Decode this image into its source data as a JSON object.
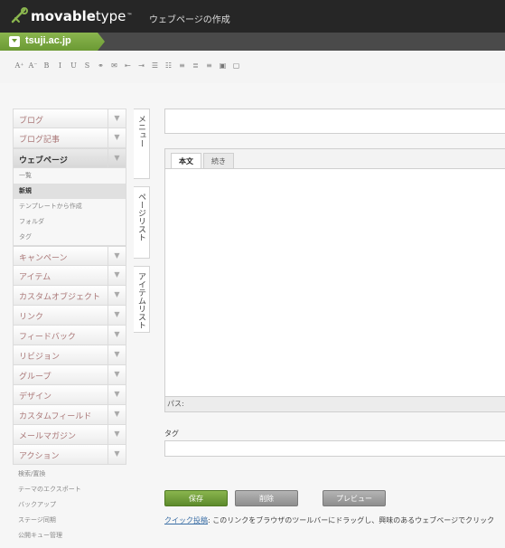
{
  "header": {
    "logo_bold": "movable",
    "logo_light": "type",
    "logo_tm": "™",
    "page_title": "ウェブページの作成"
  },
  "blog": {
    "name": "tsuji.ac.jp"
  },
  "toolbar": {
    "buttons": [
      "A⁺",
      "A⁻",
      "B",
      "I",
      "U",
      "S",
      "⚭",
      "✉",
      "⇤",
      "⇥",
      "☰",
      "☷",
      "≡",
      "≣",
      "≡",
      "▣",
      "▢"
    ]
  },
  "sidebar": {
    "menus_top": [
      {
        "label": "ブログ"
      },
      {
        "label": "ブログ記事"
      }
    ],
    "open_menu": "ウェブページ",
    "submenu": [
      {
        "label": "一覧",
        "active": false
      },
      {
        "label": "新規",
        "active": true
      },
      {
        "label": "テンプレートから作成",
        "active": false
      },
      {
        "label": "フォルダ",
        "active": false
      },
      {
        "label": "タグ",
        "active": false
      }
    ],
    "menus_bottom": [
      {
        "label": "キャンペーン"
      },
      {
        "label": "アイテム"
      },
      {
        "label": "カスタムオブジェクト"
      },
      {
        "label": "リンク"
      },
      {
        "label": "フィードバック"
      },
      {
        "label": "リビジョン"
      },
      {
        "label": "グループ"
      },
      {
        "label": "デザイン"
      },
      {
        "label": "カスタムフィールド"
      },
      {
        "label": "メールマガジン"
      },
      {
        "label": "アクション"
      }
    ],
    "extra_items": [
      "検索/置換",
      "テーマのエクスポート",
      "バックアップ",
      "ステージ同期",
      "公開キュー管理"
    ]
  },
  "vertical_tabs": {
    "menu": "メニュー",
    "page_list": "ページリスト",
    "item_list": "アイテムリスト"
  },
  "editor": {
    "tabs": [
      "本文",
      "続き"
    ],
    "path_label": "パス:"
  },
  "tags": {
    "label": "タグ"
  },
  "actions": {
    "save": "保存",
    "delete": "削除",
    "preview": "プレビュー"
  },
  "quickpost": {
    "link": "クイック投稿",
    "text": ": このリンクをブラウザのツールバーにドラッグし、興味のあるウェブページでクリック"
  }
}
